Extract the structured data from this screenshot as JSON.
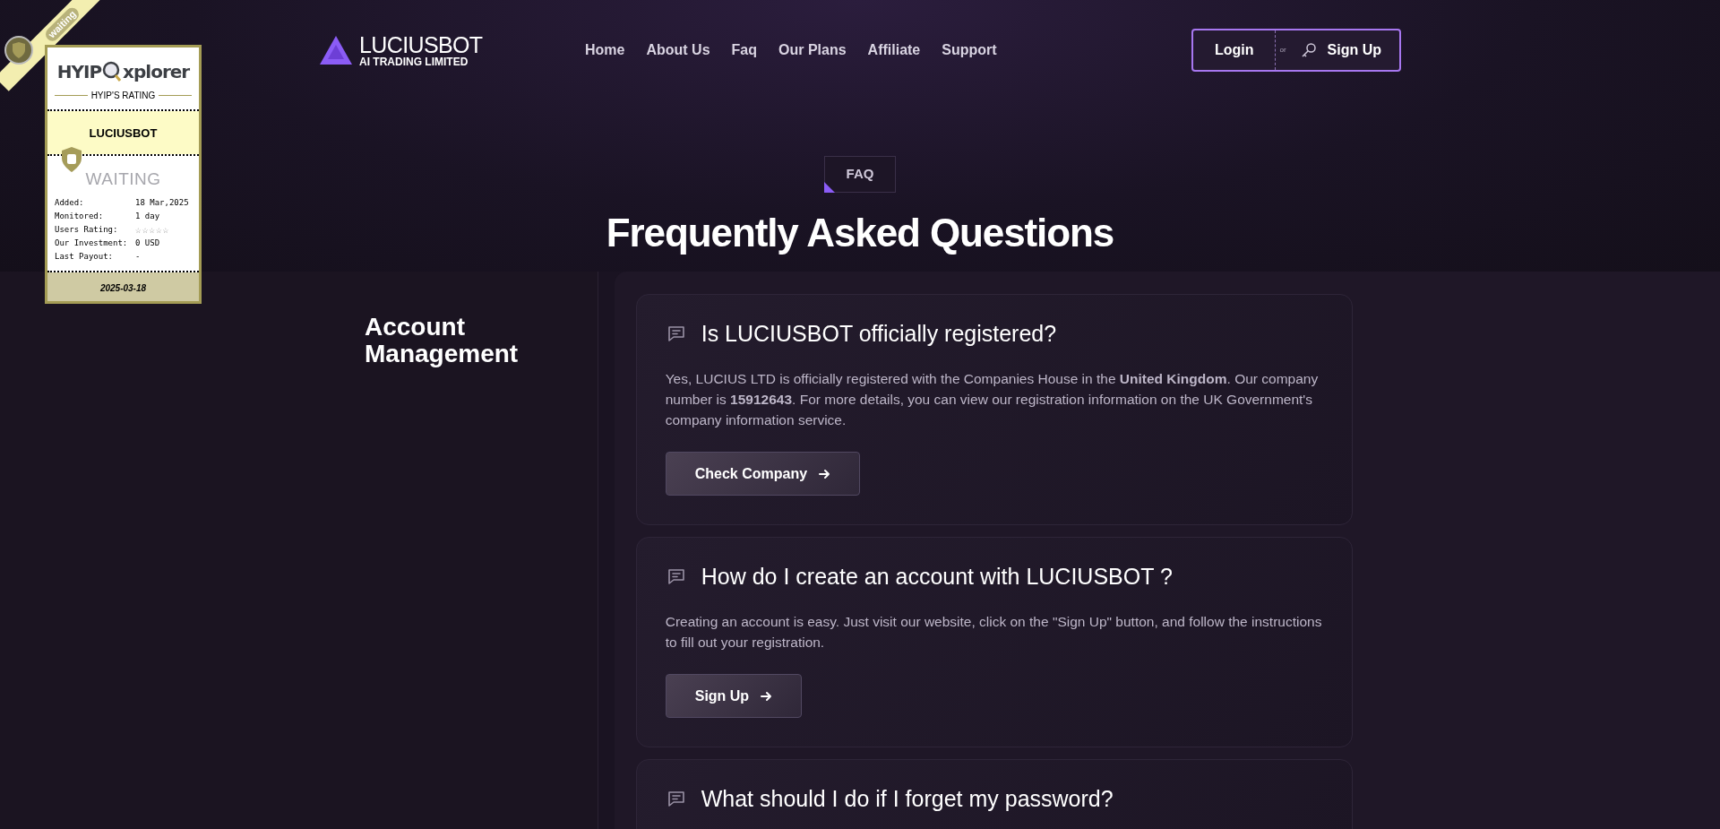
{
  "rating_badge": {
    "ribbon": "waiting",
    "brand": "HYIP",
    "brand_2": "xplorer",
    "subtitle": "HYIP'S RATING",
    "project": "LUCIUSBOT",
    "status": "WAITING",
    "rows": [
      {
        "kind": "text",
        "label": "Added:",
        "value": "18 Mar,2025"
      },
      {
        "kind": "text",
        "label": "Monitored:",
        "value": "1 day"
      },
      {
        "kind": "stars",
        "label": "Users Rating:",
        "stars": 0
      },
      {
        "kind": "text",
        "label": "Our Investment:",
        "value": "0 USD"
      },
      {
        "kind": "text",
        "label": "Last Payout:",
        "value": "-"
      }
    ],
    "date": "2025-03-18"
  },
  "header": {
    "logo": {
      "name": "LUCIUSBOT",
      "tagline": "AI TRADING LIMITED"
    },
    "nav": [
      "Home",
      "About Us",
      "Faq",
      "Our Plans",
      "Affiliate",
      "Support"
    ],
    "login": "Login",
    "separator": "or",
    "signup": "Sign Up"
  },
  "hero": {
    "tag": "FAQ",
    "title": "Frequently Asked Questions"
  },
  "category": "Account Management",
  "faqs": [
    {
      "question": "Is LUCIUSBOT officially registered?",
      "answer": "Yes, LUCIUS LTD is officially registered with the Companies House in the **United Kingdom**. Our company number is **15912643**. For more details, you can view our registration information on the UK Government's company information service.",
      "button": "Check Company"
    },
    {
      "question": "How do I create an account with LUCIUSBOT ?",
      "answer": "Creating an account is easy. Just visit our website, click on the \"Sign Up\" button, and follow the instructions to fill out your registration.",
      "button": "Sign Up"
    },
    {
      "question": "What should I do if I forget my password?"
    }
  ]
}
